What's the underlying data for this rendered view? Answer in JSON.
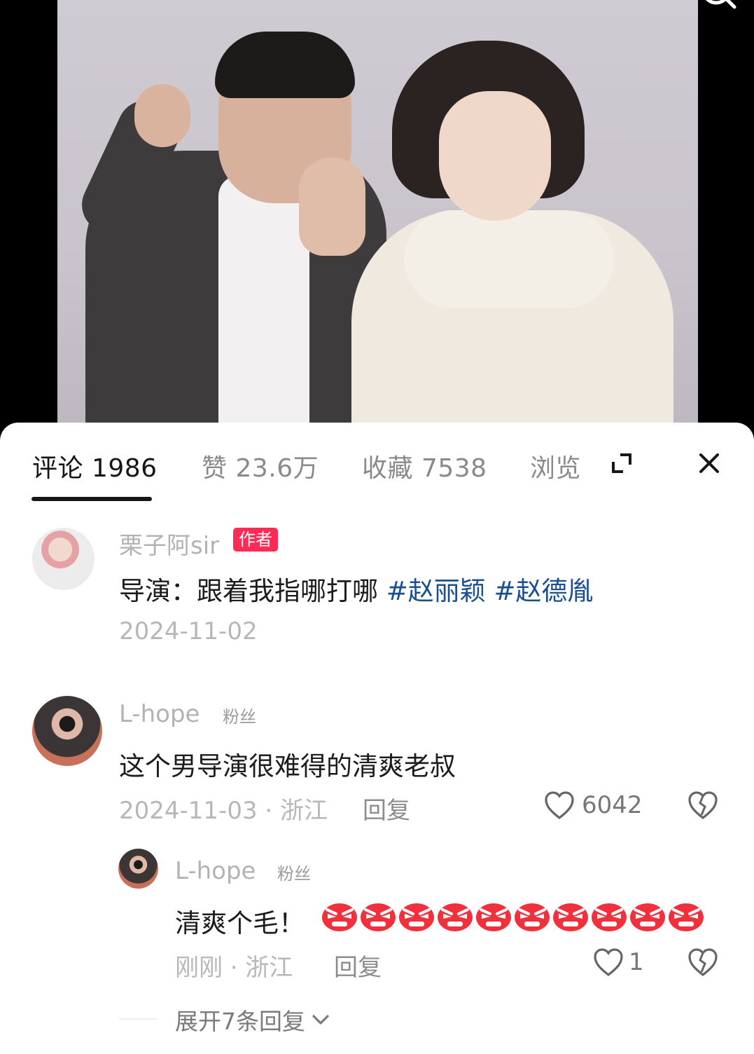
{
  "tabs": {
    "comments": "评论 1986",
    "likes": "赞 23.6万",
    "favorites": "收藏 7538",
    "views": "浏览"
  },
  "comments": [
    {
      "username": "栗子阿sir",
      "badge": "作者",
      "text_plain": "导演：跟着我指哪打哪 ",
      "hashtag1": "#赵丽颖",
      "hashtag2": "#赵德胤",
      "date": "2024-11-02"
    },
    {
      "username": "L-hope",
      "badge": "粉丝",
      "text": "这个男导演很难得的清爽老叔",
      "meta": "2024-11-03 · 浙江",
      "reply": "回复",
      "likes": "6042"
    }
  ],
  "reply": {
    "username": "L-hope",
    "badge": "粉丝",
    "text": "清爽个毛！",
    "emoji_icon": "angry-face-emoji",
    "emoji_count": 10,
    "meta": "刚刚 · 浙江",
    "reply": "回复",
    "likes": "1"
  },
  "expand_replies": "展开7条回复",
  "colors": {
    "author_badge": "#ff2a55",
    "hashtag": "#1b4f8f",
    "active_tab": "#161616"
  }
}
